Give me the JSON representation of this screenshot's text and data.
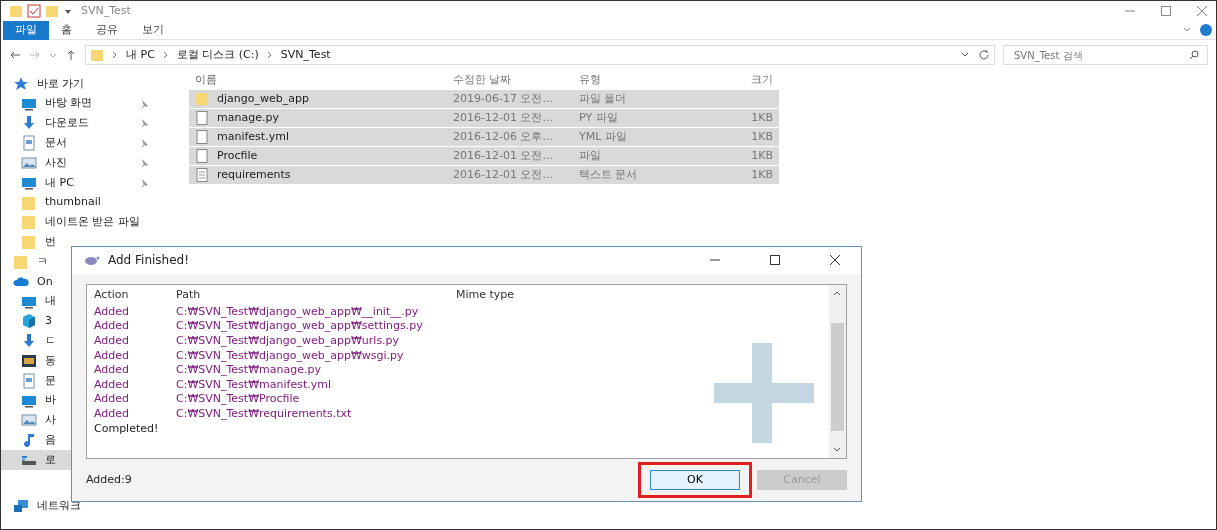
{
  "window": {
    "title": "SVN_Test"
  },
  "ribbon_tabs": [
    {
      "label": "파일",
      "selected": true
    },
    {
      "label": "홈",
      "selected": false
    },
    {
      "label": "공유",
      "selected": false
    },
    {
      "label": "보기",
      "selected": false
    }
  ],
  "address": {
    "crumbs": [
      "내 PC",
      "로컬 디스크 (C:)",
      "SVN_Test"
    ]
  },
  "search": {
    "placeholder": "SVN_Test 검색"
  },
  "sidebar": {
    "items": [
      {
        "label": "바로 가기",
        "kind": "star",
        "pinned": false,
        "selected": false,
        "heading": true
      },
      {
        "label": "바탕 화면",
        "kind": "desktop",
        "pinned": true,
        "selected": false,
        "heading": false
      },
      {
        "label": "다운로드",
        "kind": "download",
        "pinned": true,
        "selected": false,
        "heading": false
      },
      {
        "label": "문서",
        "kind": "doc",
        "pinned": true,
        "selected": false,
        "heading": false
      },
      {
        "label": "사진",
        "kind": "picture",
        "pinned": true,
        "selected": false,
        "heading": false
      },
      {
        "label": "내 PC",
        "kind": "desktop",
        "pinned": true,
        "selected": false,
        "heading": false
      },
      {
        "label": "thumbnail",
        "kind": "folder",
        "pinned": false,
        "selected": false,
        "heading": false
      },
      {
        "label": "네이트온 받은 파일",
        "kind": "folder",
        "pinned": false,
        "selected": false,
        "heading": false
      },
      {
        "label": "번",
        "kind": "folder",
        "selected": false,
        "heading": false
      },
      {
        "label": "ㅋ",
        "kind": "folder",
        "selected": false,
        "heading": true
      },
      {
        "label": "On",
        "kind": "cloud",
        "selected": false,
        "heading": true
      },
      {
        "label": "내",
        "kind": "desktop",
        "selected": false,
        "heading": false
      },
      {
        "label": "3",
        "kind": "cube",
        "selected": false,
        "heading": false
      },
      {
        "label": "ㄷ",
        "kind": "download",
        "selected": false,
        "heading": false
      },
      {
        "label": "동",
        "kind": "video",
        "selected": false,
        "heading": false
      },
      {
        "label": "문",
        "kind": "doc",
        "selected": false,
        "heading": false
      },
      {
        "label": "바",
        "kind": "desktop",
        "selected": false,
        "heading": false
      },
      {
        "label": "사",
        "kind": "picture",
        "selected": false,
        "heading": false
      },
      {
        "label": "음",
        "kind": "music",
        "selected": false,
        "heading": false
      },
      {
        "label": "로",
        "kind": "drive",
        "selected": true,
        "heading": false
      },
      {
        "label": "네트워크",
        "kind": "network",
        "pinned": false,
        "selected": false,
        "heading": true
      }
    ]
  },
  "file_list": {
    "columns": [
      "이름",
      "수정한 날짜",
      "유형",
      "크기"
    ],
    "rows": [
      {
        "name": "django_web_app",
        "date": "2019-06-17 오전...",
        "type": "파일 폴더",
        "size": "",
        "kind": "folder",
        "selected": true
      },
      {
        "name": "manage.py",
        "date": "2016-12-01 오전...",
        "type": "PY 파일",
        "size": "1KB",
        "kind": "file",
        "selected": true
      },
      {
        "name": "manifest.yml",
        "date": "2016-12-06 오후...",
        "type": "YML 파일",
        "size": "1KB",
        "kind": "file",
        "selected": true
      },
      {
        "name": "Procfile",
        "date": "2016-12-01 오전...",
        "type": "파일",
        "size": "1KB",
        "kind": "file",
        "selected": true
      },
      {
        "name": "requirements",
        "date": "2016-12-01 오전...",
        "type": "텍스트 문서",
        "size": "1KB",
        "kind": "text",
        "selected": true
      }
    ]
  },
  "dialog": {
    "title": "Add Finished!",
    "columns": [
      "Action",
      "Path",
      "Mime type"
    ],
    "rows": [
      {
        "action": "Added",
        "path": "C:₩SVN_Test₩django_web_app₩__init__.py",
        "kind": "added"
      },
      {
        "action": "Added",
        "path": "C:₩SVN_Test₩django_web_app₩settings.py",
        "kind": "added"
      },
      {
        "action": "Added",
        "path": "C:₩SVN_Test₩django_web_app₩urls.py",
        "kind": "added"
      },
      {
        "action": "Added",
        "path": "C:₩SVN_Test₩django_web_app₩wsgi.py",
        "kind": "added"
      },
      {
        "action": "Added",
        "path": "C:₩SVN_Test₩manage.py",
        "kind": "added"
      },
      {
        "action": "Added",
        "path": "C:₩SVN_Test₩manifest.yml",
        "kind": "added"
      },
      {
        "action": "Added",
        "path": "C:₩SVN_Test₩Procfile",
        "kind": "added"
      },
      {
        "action": "Added",
        "path": "C:₩SVN_Test₩requirements.txt",
        "kind": "added"
      },
      {
        "action": "Completed!",
        "path": "",
        "kind": "completed"
      }
    ],
    "summary": "Added:9",
    "buttons": [
      {
        "label": "OK",
        "disabled": false,
        "highlighted": true
      },
      {
        "label": "Cancel",
        "disabled": true,
        "highlighted": false
      }
    ]
  }
}
